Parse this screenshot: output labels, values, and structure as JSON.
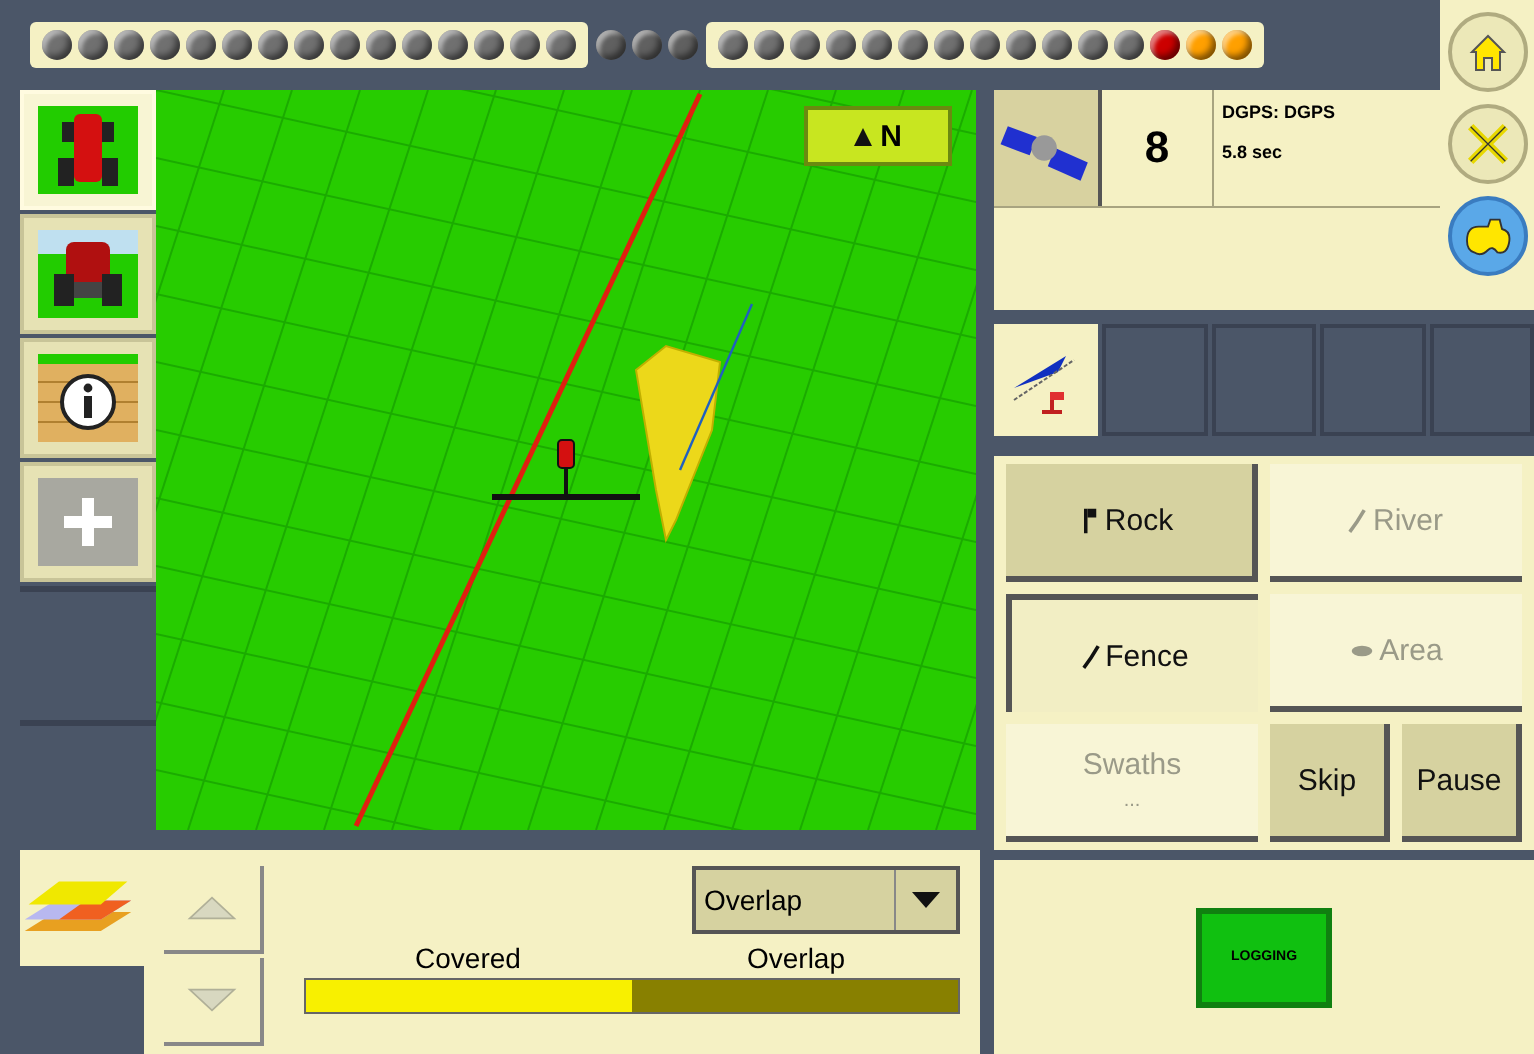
{
  "status_lights": [
    {
      "kind": "panel",
      "lights": [
        {
          "color": "#707070"
        },
        {
          "color": "#707070"
        },
        {
          "color": "#707070"
        },
        {
          "color": "#707070"
        },
        {
          "color": "#707070"
        },
        {
          "color": "#707070"
        },
        {
          "color": "#707070"
        },
        {
          "color": "#707070"
        },
        {
          "color": "#707070"
        },
        {
          "color": "#707070"
        },
        {
          "color": "#707070"
        },
        {
          "color": "#707070"
        },
        {
          "color": "#707070"
        },
        {
          "color": "#707070"
        },
        {
          "color": "#707070"
        }
      ]
    },
    {
      "kind": "plain",
      "lights": [
        {
          "color": "#606060"
        },
        {
          "color": "#606060"
        },
        {
          "color": "#606060"
        }
      ]
    },
    {
      "kind": "panel",
      "lights": [
        {
          "color": "#707070"
        },
        {
          "color": "#707070"
        },
        {
          "color": "#707070"
        },
        {
          "color": "#707070"
        },
        {
          "color": "#707070"
        },
        {
          "color": "#707070"
        },
        {
          "color": "#707070"
        },
        {
          "color": "#707070"
        },
        {
          "color": "#707070"
        },
        {
          "color": "#707070"
        },
        {
          "color": "#707070"
        },
        {
          "color": "#707070"
        },
        {
          "color": "#cc0000"
        },
        {
          "color": "#ffa000"
        },
        {
          "color": "#ffa000"
        }
      ]
    }
  ],
  "side_menu": [
    {
      "kind": "home",
      "selected": false
    },
    {
      "kind": "tools",
      "selected": false
    },
    {
      "kind": "tractor",
      "selected": true
    }
  ],
  "left_toolbar": [
    {
      "kind": "tractor-top",
      "selected": true
    },
    {
      "kind": "tractor-front",
      "selected": false
    },
    {
      "kind": "info",
      "selected": false
    },
    {
      "kind": "add",
      "selected": false
    }
  ],
  "map": {
    "compass": "N"
  },
  "gps": {
    "satellites": "8",
    "mode": "DGPS: DGPS",
    "age": "5.8 sec"
  },
  "tabs": [
    {
      "kind": "guidance",
      "selected": true
    },
    {
      "kind": "empty",
      "selected": false
    },
    {
      "kind": "empty",
      "selected": false
    },
    {
      "kind": "empty",
      "selected": false
    },
    {
      "kind": "empty",
      "selected": false
    }
  ],
  "mapping_buttons": [
    {
      "label": "Rock",
      "kind": "point",
      "selected": false,
      "disabled": false
    },
    {
      "label": "River",
      "kind": "line",
      "selected": false,
      "disabled": true
    },
    {
      "label": "Fence",
      "kind": "line",
      "selected": true,
      "disabled": false
    },
    {
      "label": "Area",
      "kind": "area",
      "selected": false,
      "disabled": true
    },
    {
      "label": "Swaths",
      "sub": "...",
      "kind": "plain",
      "selected": false,
      "disabled": true
    },
    {
      "label": "Skip",
      "kind": "plain",
      "selected": false,
      "disabled": false
    },
    {
      "label": "Pause",
      "kind": "plain",
      "selected": false,
      "disabled": false
    }
  ],
  "coverage": {
    "dropdown": "Overlap",
    "legend": [
      "Covered",
      "Overlap"
    ],
    "level": 0.5
  },
  "logging": {
    "label": "LOGGING",
    "on": true
  }
}
